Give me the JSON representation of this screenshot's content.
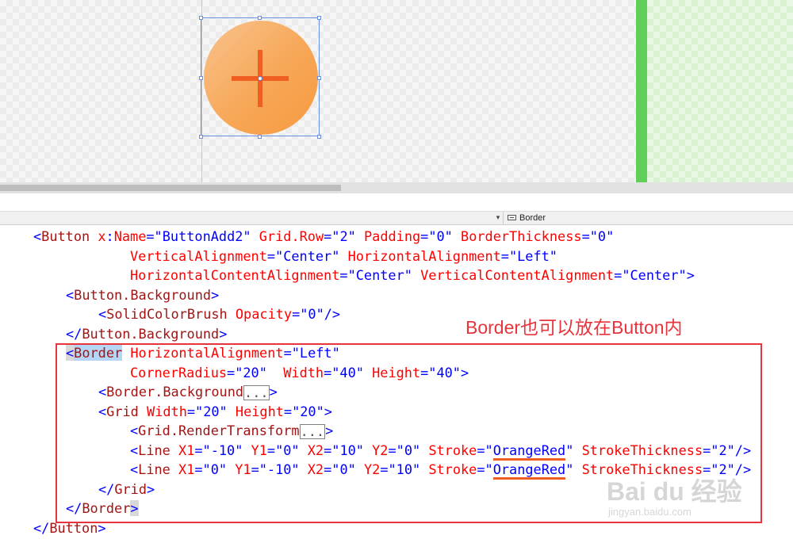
{
  "breadcrumb": {
    "arrow": "▾",
    "label": "Border"
  },
  "code_lines": [
    {
      "tokens": [
        {
          "c": "b",
          "t": "<"
        },
        {
          "c": "m",
          "t": "Button"
        },
        {
          "c": "r",
          "t": " x"
        },
        {
          "c": "b",
          "t": ":"
        },
        {
          "c": "r",
          "t": "Name"
        },
        {
          "c": "b",
          "t": "=\"ButtonAdd2\""
        },
        {
          "c": "r",
          "t": " Grid.Row"
        },
        {
          "c": "b",
          "t": "=\"2\""
        },
        {
          "c": "r",
          "t": " Padding"
        },
        {
          "c": "b",
          "t": "=\"0\""
        },
        {
          "c": "r",
          "t": " BorderThickness"
        },
        {
          "c": "b",
          "t": "=\"0\""
        }
      ]
    },
    {
      "tokens": [
        {
          "c": "r",
          "t": "VerticalAlignment"
        },
        {
          "c": "b",
          "t": "=\"Center\""
        },
        {
          "c": "r",
          "t": " HorizontalAlignment"
        },
        {
          "c": "b",
          "t": "=\"Left\""
        }
      ]
    },
    {
      "tokens": [
        {
          "c": "r",
          "t": "HorizontalContentAlignment"
        },
        {
          "c": "b",
          "t": "=\"Center\""
        },
        {
          "c": "r",
          "t": " VerticalContentAlignment"
        },
        {
          "c": "b",
          "t": "=\"Center\">"
        }
      ]
    },
    {
      "tokens": [
        {
          "c": "b",
          "t": "<"
        },
        {
          "c": "m",
          "t": "Button.Background"
        },
        {
          "c": "b",
          "t": ">"
        }
      ]
    },
    {
      "tokens": [
        {
          "c": "b",
          "t": "<"
        },
        {
          "c": "m",
          "t": "SolidColorBrush"
        },
        {
          "c": "r",
          "t": " Opacity"
        },
        {
          "c": "b",
          "t": "=\"0\"/>"
        }
      ]
    },
    {
      "tokens": [
        {
          "c": "b",
          "t": "</"
        },
        {
          "c": "m",
          "t": "Button.Background"
        },
        {
          "c": "b",
          "t": ">"
        }
      ]
    },
    {
      "tokens": [
        {
          "c": "b bh",
          "t": "<"
        },
        {
          "c": "m hl",
          "t": "Border"
        },
        {
          "c": "r",
          "t": " HorizontalAlignment"
        },
        {
          "c": "b",
          "t": "=\"Left\""
        }
      ]
    },
    {
      "tokens": [
        {
          "c": "r",
          "t": "CornerRadius"
        },
        {
          "c": "b",
          "t": "=\"20\""
        },
        {
          "c": "r",
          "t": "  Width"
        },
        {
          "c": "b",
          "t": "=\"40\""
        },
        {
          "c": "r",
          "t": " Height"
        },
        {
          "c": "b",
          "t": "=\"40\">"
        }
      ]
    },
    {
      "tokens": [
        {
          "c": "b",
          "t": "<"
        },
        {
          "c": "m",
          "t": "Border.Background"
        },
        {
          "c": "col",
          "t": "..."
        },
        {
          "c": "b",
          "t": ">"
        }
      ]
    },
    {
      "tokens": [
        {
          "c": "b",
          "t": "<"
        },
        {
          "c": "m",
          "t": "Grid"
        },
        {
          "c": "r",
          "t": " Width"
        },
        {
          "c": "b",
          "t": "=\"20\""
        },
        {
          "c": "r",
          "t": " Height"
        },
        {
          "c": "b",
          "t": "=\"20\">"
        }
      ]
    },
    {
      "tokens": [
        {
          "c": "b",
          "t": "<"
        },
        {
          "c": "m",
          "t": "Grid.RenderTransform"
        },
        {
          "c": "col",
          "t": "..."
        },
        {
          "c": "b",
          "t": ">"
        }
      ]
    },
    {
      "tokens": [
        {
          "c": "b",
          "t": "<"
        },
        {
          "c": "m",
          "t": "Line"
        },
        {
          "c": "r",
          "t": " X1"
        },
        {
          "c": "b",
          "t": "=\"-10\""
        },
        {
          "c": "r",
          "t": " Y1"
        },
        {
          "c": "b",
          "t": "=\"0\""
        },
        {
          "c": "r",
          "t": " X2"
        },
        {
          "c": "b",
          "t": "=\"10\""
        },
        {
          "c": "r",
          "t": " Y2"
        },
        {
          "c": "b",
          "t": "=\"0\""
        },
        {
          "c": "r",
          "t": " Stroke"
        },
        {
          "c": "b",
          "t": "=\""
        },
        {
          "c": "b ul",
          "t": "OrangeRed"
        },
        {
          "c": "b",
          "t": "\""
        },
        {
          "c": "r",
          "t": " StrokeThickness"
        },
        {
          "c": "b",
          "t": "=\"2\"/>"
        }
      ]
    },
    {
      "tokens": [
        {
          "c": "b",
          "t": "<"
        },
        {
          "c": "m",
          "t": "Line"
        },
        {
          "c": "r",
          "t": " X1"
        },
        {
          "c": "b",
          "t": "=\"0\""
        },
        {
          "c": "r",
          "t": " Y1"
        },
        {
          "c": "b",
          "t": "=\"-10\""
        },
        {
          "c": "r",
          "t": " X2"
        },
        {
          "c": "b",
          "t": "=\"0\""
        },
        {
          "c": "r",
          "t": " Y2"
        },
        {
          "c": "b",
          "t": "=\"10\""
        },
        {
          "c": "r",
          "t": " Stroke"
        },
        {
          "c": "b",
          "t": "=\""
        },
        {
          "c": "b ul",
          "t": "OrangeRed"
        },
        {
          "c": "b",
          "t": "\""
        },
        {
          "c": "r",
          "t": " StrokeThickness"
        },
        {
          "c": "b",
          "t": "=\"2\"/>"
        }
      ]
    },
    {
      "tokens": [
        {
          "c": "b",
          "t": "</"
        },
        {
          "c": "m",
          "t": "Grid"
        },
        {
          "c": "b",
          "t": ">"
        }
      ]
    },
    {
      "tokens": [
        {
          "c": "b",
          "t": "</"
        },
        {
          "c": "m",
          "t": "Border"
        },
        {
          "c": "b bh",
          "t": ">"
        }
      ]
    },
    {
      "tokens": [
        {
          "c": "b",
          "t": "</"
        },
        {
          "c": "m",
          "t": "Button"
        },
        {
          "c": "b",
          "t": ">"
        }
      ]
    }
  ],
  "annotation": "Border也可以放在Button内",
  "watermark": {
    "main": "Bai du 经验",
    "sub": "jingyan.baidu.com"
  },
  "colors": {
    "annotation_red": "#e8343c",
    "orange_red": "#f05e22",
    "green_bar": "#5fcf5a",
    "selection_blue": "#6b8fe0"
  }
}
